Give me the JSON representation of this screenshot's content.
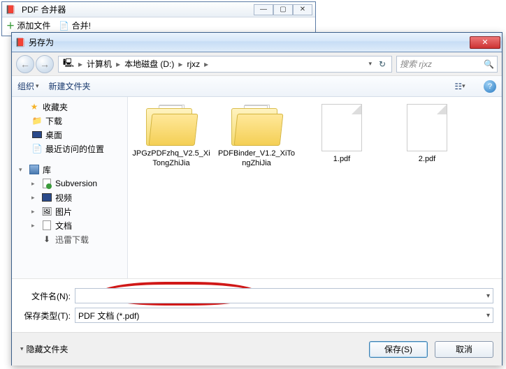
{
  "app": {
    "title": "PDF 合并器",
    "add_files": "添加文件",
    "merge": "合并!"
  },
  "dialog": {
    "title": "另存为",
    "close_glyph": "✕"
  },
  "nav": {
    "back_glyph": "←",
    "fwd_glyph": "→"
  },
  "breadcrumb": {
    "computer_icon": "🖳",
    "parts": [
      "计算机",
      "本地磁盘 (D:)",
      "rjxz"
    ],
    "sep": "▸",
    "refresh_glyph": "↻"
  },
  "search": {
    "placeholder": "搜索 rjxz",
    "mag_glyph": "🔍"
  },
  "toolbar": {
    "organize": "组织",
    "new_folder": "新建文件夹",
    "caret": "▾"
  },
  "tree": {
    "favorites": "收藏夹",
    "downloads": "下载",
    "desktop": "桌面",
    "recent": "最近访问的位置",
    "libraries": "库",
    "subversion": "Subversion",
    "videos": "视频",
    "pictures": "图片",
    "documents": "文档",
    "thunder": "迅雷下载"
  },
  "files": [
    {
      "name": "JPGzPDFzhq_V2.5_XiTongZhiJia",
      "type": "folder"
    },
    {
      "name": "PDFBinder_V1.2_XiTongZhiJia",
      "type": "folder"
    },
    {
      "name": "1.pdf",
      "type": "pdf"
    },
    {
      "name": "2.pdf",
      "type": "pdf"
    }
  ],
  "fields": {
    "filename_label": "文件名(N):",
    "filename_value": "",
    "filetype_label": "保存类型(T):",
    "filetype_value": "PDF 文档 (*.pdf)"
  },
  "footer": {
    "hide_folders": "隐藏文件夹",
    "save": "保存(S)",
    "cancel": "取消",
    "caret": "▴"
  },
  "help_glyph": "?"
}
